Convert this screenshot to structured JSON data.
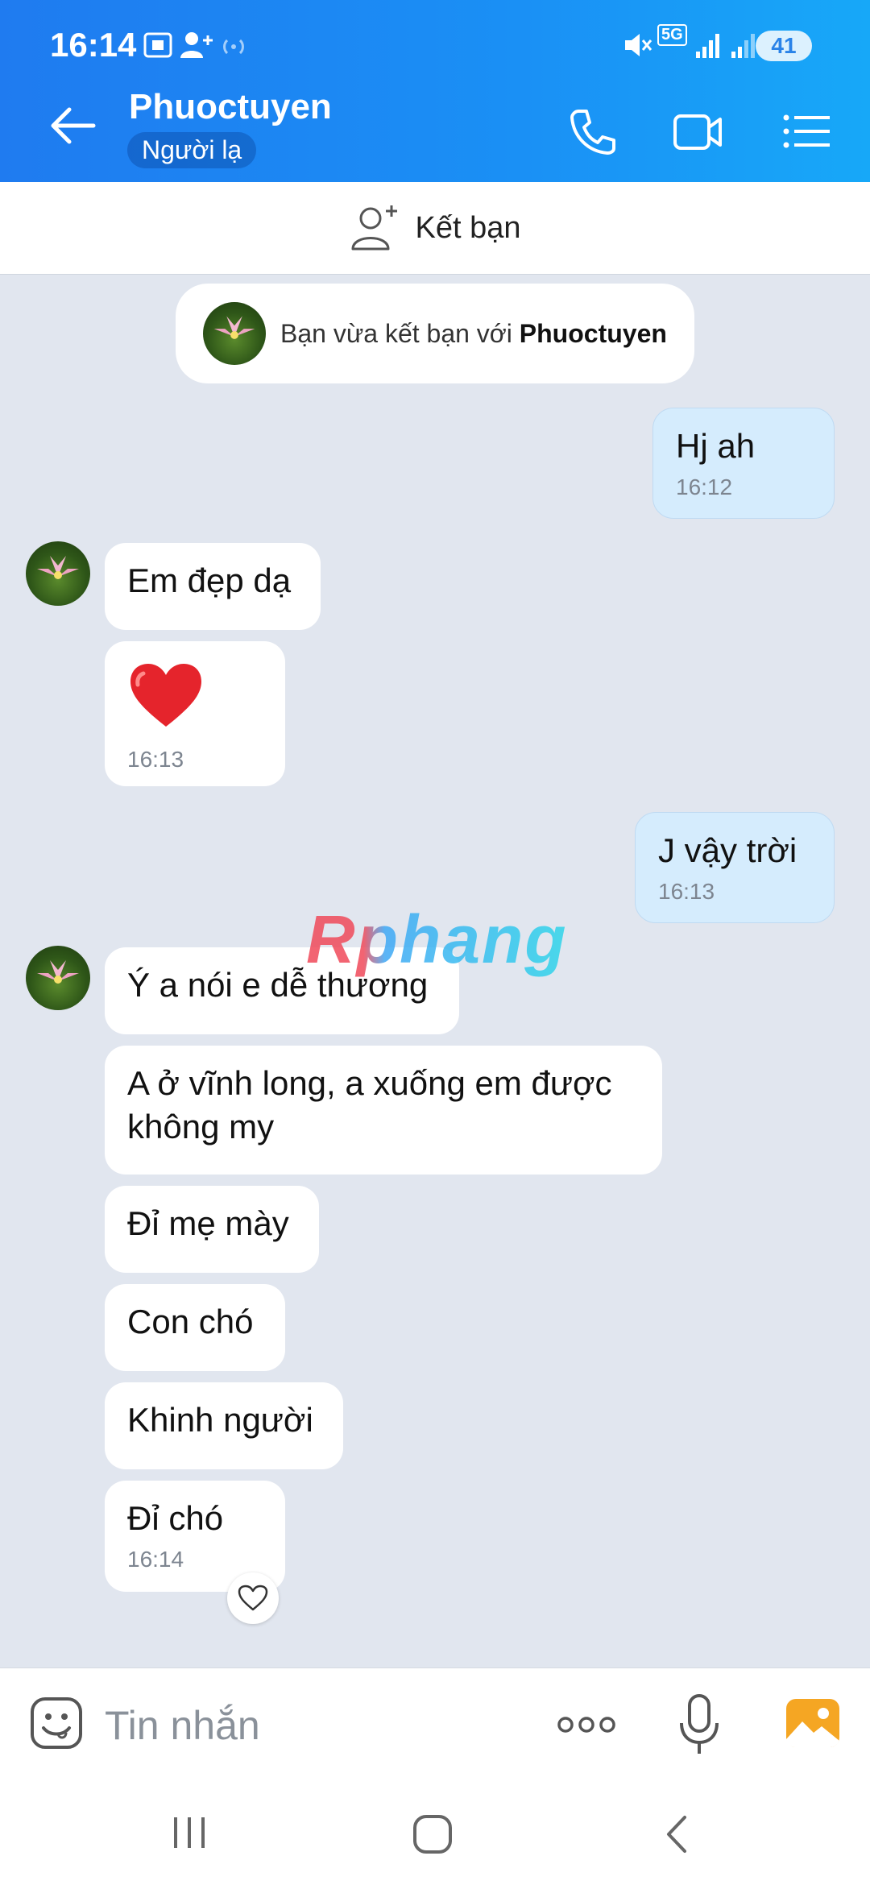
{
  "status_bar": {
    "time": "16:14",
    "battery": "41",
    "network": "5G"
  },
  "header": {
    "title": "Phuoctuyen",
    "subtitle": "Người lạ"
  },
  "friend_bar": {
    "label": "Kết bạn"
  },
  "notice": {
    "prefix": "Bạn vừa kết bạn với ",
    "name": "Phuoctuyen"
  },
  "messages": [
    {
      "from": "me",
      "text": "Hj ah",
      "time": "16:12"
    },
    {
      "from": "them",
      "text": "Em đẹp dạ"
    },
    {
      "from": "them",
      "text": "❤️",
      "time": "16:13"
    },
    {
      "from": "me",
      "text": "J vậy trời",
      "time": "16:13"
    },
    {
      "from": "them",
      "text": "Ý a nói e dễ thương"
    },
    {
      "from": "them",
      "text": "A ở vĩnh long, a xuống em được không my"
    },
    {
      "from": "them",
      "text": "Đỉ mẹ mày"
    },
    {
      "from": "them",
      "text": "Con chó"
    },
    {
      "from": "them",
      "text": "Khinh người"
    },
    {
      "from": "them",
      "text": "Đỉ chó",
      "time": "16:14"
    }
  ],
  "watermark": "Rphang",
  "composer": {
    "placeholder": "Tin nhắn"
  },
  "colors": {
    "header_gradient_start": "#1f7bf0",
    "header_gradient_end": "#17a8f8",
    "my_bubble": "#d5ecfd",
    "chat_background": "#e1e6ef"
  }
}
